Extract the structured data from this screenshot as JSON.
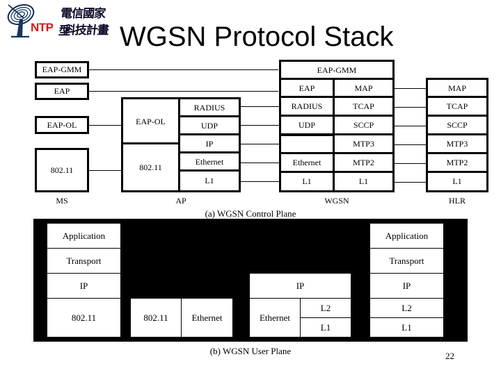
{
  "slide": {
    "title": "WGSN Protocol Stack",
    "page_number": "22"
  },
  "logo": {
    "acronym": "NTP",
    "chinese_line1": "電信國家型",
    "chinese_line2": "科技計畫",
    "icon": "satellite-dish-icon",
    "accent_color": "#d21a1a"
  },
  "control_plane": {
    "caption": "(a) WGSN Control Plane",
    "node_labels": {
      "ms": "MS",
      "ap": "AP",
      "wgsn": "WGSN",
      "hlr": "HLR"
    },
    "ms_stack": [
      "EAP-GMM",
      "EAP",
      "EAP-OL",
      "802.11"
    ],
    "ap_left_stack": [
      "EAP-OL",
      "802.11"
    ],
    "ap_right_stack": [
      "RADIUS",
      "UDP",
      "IP",
      "Ethernet",
      "L1"
    ],
    "wgsn_top": "EAP-GMM",
    "wgsn_left_stack": [
      "EAP",
      "RADIUS",
      "UDP",
      "",
      "Ethernet",
      "L1"
    ],
    "wgsn_right_stack": [
      "MAP",
      "TCAP",
      "SCCP",
      "MTP3",
      "MTP2",
      "L1"
    ],
    "hlr_stack": [
      "MAP",
      "TCAP",
      "SCCP",
      "MTP3",
      "MTP2",
      "L1"
    ]
  },
  "user_plane": {
    "caption": "(b) WGSN User Plane",
    "background_color": "#000000",
    "ms_stack": [
      "Application",
      "Transport",
      "IP",
      "802.11"
    ],
    "ap_stack": [
      "802.11",
      "Ethernet"
    ],
    "wgsn_top": "IP",
    "wgsn_left": "Ethernet",
    "wgsn_right_stack": [
      "L2",
      "L1"
    ],
    "server_stack": [
      "Application",
      "Transport",
      "IP",
      "L2",
      "L1"
    ]
  }
}
